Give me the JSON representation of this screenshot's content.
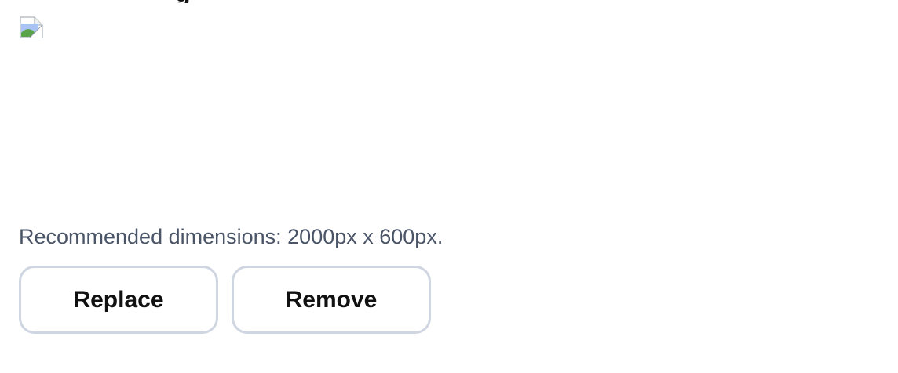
{
  "header": {
    "title_partial": "g"
  },
  "image": {
    "icon": "broken-image-icon"
  },
  "hint": {
    "text": "Recommended dimensions: 2000px x 600px."
  },
  "actions": {
    "replace_label": "Replace",
    "remove_label": "Remove"
  },
  "colors": {
    "hint_text": "#4a5568",
    "button_border": "#cfd6e1",
    "text": "#111111"
  }
}
